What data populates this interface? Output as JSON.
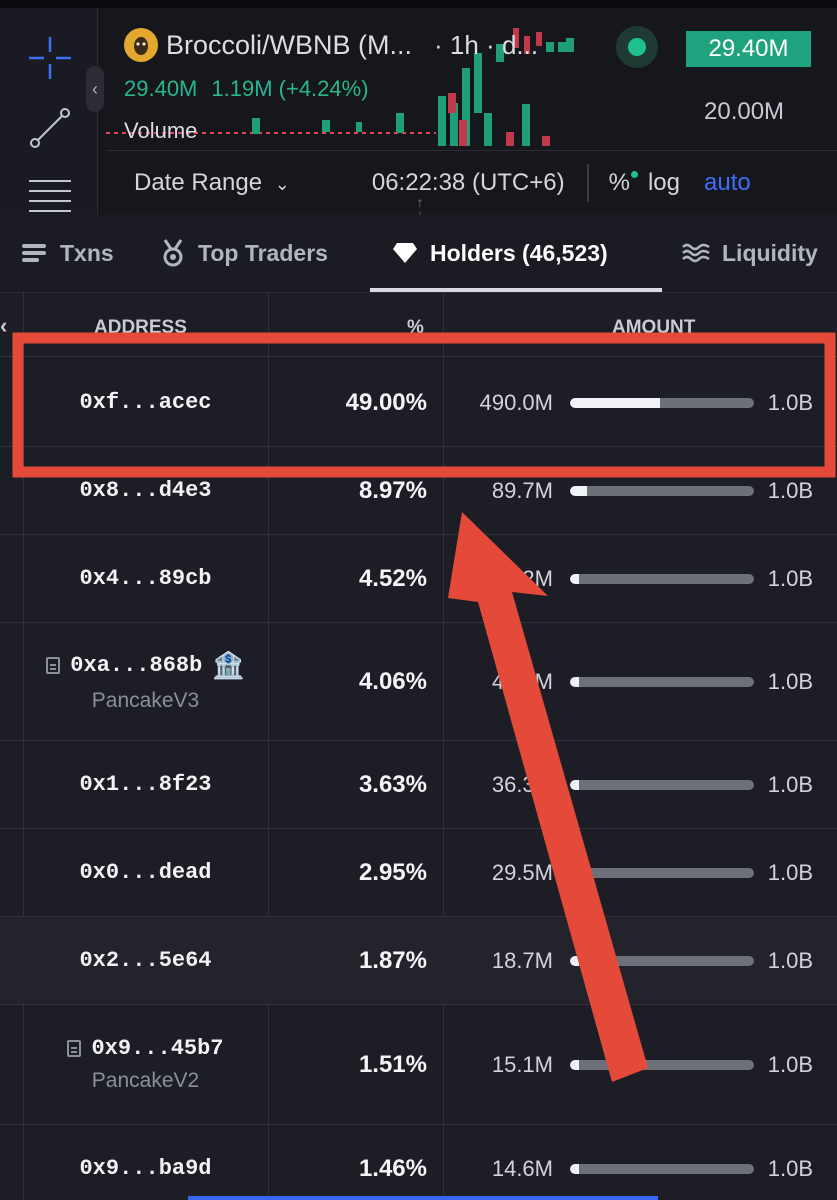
{
  "chart_header": {
    "pair_name": "Broccoli/WBNB (M...",
    "interval": "· 1h · d...",
    "stat_value": "29.40M",
    "stat_change": "1.19M (+4.24%)",
    "volume_label": "Volume",
    "price_tag": "29.40M",
    "price_level": "20.00M",
    "colors": {
      "up": "#1fc08f",
      "down": "#e0455a",
      "accent": "#3d6ef5"
    }
  },
  "chart_toolbar": {
    "date_range_label": "Date Range",
    "time": "06:22:38 (UTC+6)",
    "percent_label": "%",
    "log_label": "log",
    "auto_label": "auto"
  },
  "left_tools": [
    "crosshair-icon",
    "trend-line-icon",
    "fib-lines-icon"
  ],
  "tabs": [
    {
      "label": "Txns",
      "icon": "list-icon"
    },
    {
      "label": "Top Traders",
      "icon": "medal-icon"
    },
    {
      "label": "Holders (46,523)",
      "icon": "diamond-icon",
      "active": true
    },
    {
      "label": "Liquidity",
      "icon": "waves-icon"
    }
  ],
  "table": {
    "headers": {
      "address": "ADDRESS",
      "percent": "%",
      "amount": "AMOUNT"
    },
    "total_supply": "1.0B",
    "rows": [
      {
        "address": "0xf...acec",
        "percent": "49.00%",
        "amount": "490.0M",
        "total": "1.0B",
        "fill": 0.49
      },
      {
        "address": "0x8...d4e3",
        "percent": "8.97%",
        "amount": "89.7M",
        "total": "1.0B",
        "fill": 0.0897
      },
      {
        "address": "0x4...89cb",
        "percent": "4.52%",
        "amount": "45.2M",
        "total": "1.0B",
        "fill": 0.0452
      },
      {
        "address": "0xa...868b",
        "label": "PancakeV3",
        "percent": "4.06%",
        "amount": "40.6M",
        "total": "1.0B",
        "fill": 0.0406
      },
      {
        "address": "0x1...8f23",
        "percent": "3.63%",
        "amount": "36.3M",
        "total": "1.0B",
        "fill": 0.0363
      },
      {
        "address": "0x0...dead",
        "percent": "2.95%",
        "amount": "29.5M",
        "total": "1.0B",
        "fill": 0.0295
      },
      {
        "address": "0x2...5e64",
        "percent": "1.87%",
        "amount": "18.7M",
        "total": "1.0B",
        "fill": 0.0187
      },
      {
        "address": "0x9...45b7",
        "label": "PancakeV2",
        "percent": "1.51%",
        "amount": "15.1M",
        "total": "1.0B",
        "fill": 0.0151
      },
      {
        "address": "0x9...ba9d",
        "percent": "1.46%",
        "amount": "14.6M",
        "total": "1.0B",
        "fill": 0.0146
      }
    ]
  },
  "annotation": {
    "color": "#e5493a"
  }
}
